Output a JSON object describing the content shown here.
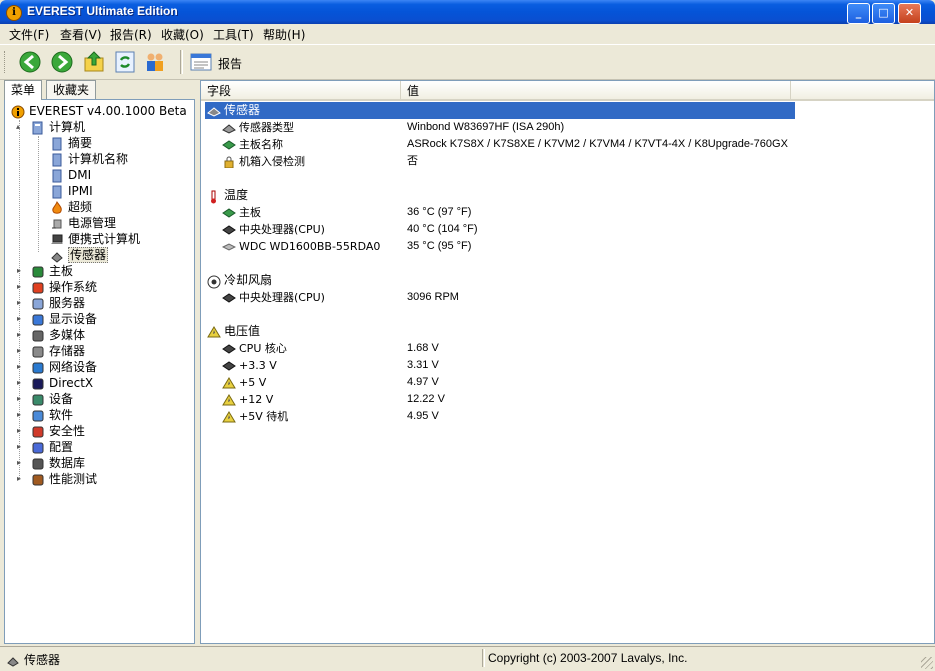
{
  "window": {
    "title": "EVEREST Ultimate Edition",
    "minimize": "_",
    "maximize": "□",
    "close": "✕"
  },
  "menubar": [
    "文件(F)",
    "查看(V)",
    "报告(R)",
    "收藏(O)",
    "工具(T)",
    "帮助(H)"
  ],
  "toolbar": {
    "report_label": "报告"
  },
  "left_tabs": [
    "菜单",
    "收藏夹"
  ],
  "tree": {
    "root": "EVEREST v4.00.1000 Beta",
    "computer": "计算机",
    "computer_children": [
      "摘要",
      "计算机名称",
      "DMI",
      "IPMI",
      "超频",
      "电源管理",
      "便携式计算机",
      "传感器"
    ],
    "top_items": [
      "主板",
      "操作系统",
      "服务器",
      "显示设备",
      "多媒体",
      "存储器",
      "网络设备",
      "DirectX",
      "设备",
      "软件",
      "安全性",
      "配置",
      "数据库",
      "性能测试"
    ]
  },
  "columns": {
    "field": "字段",
    "value": "值"
  },
  "sections": [
    {
      "title": "传感器",
      "rows": [
        {
          "field": "传感器类型",
          "value": "Winbond W83697HF  (ISA 290h)",
          "icon": "chip"
        },
        {
          "field": "主板名称",
          "value": "ASRock K7S8X / K7S8XE / K7VM2 / K7VM4 / K7VT4-4X / K8Upgrade-760GX",
          "icon": "board"
        },
        {
          "field": "机箱入侵检测",
          "value": "否",
          "icon": "lock"
        }
      ]
    },
    {
      "title": "温度",
      "rows": [
        {
          "field": "主板",
          "value": "36 °C  (97 °F)",
          "icon": "board"
        },
        {
          "field": "中央处理器(CPU)",
          "value": "40 °C  (104 °F)",
          "icon": "cpu"
        },
        {
          "field": "WDC WD1600BB-55RDA0",
          "value": "35 °C  (95 °F)",
          "icon": "hdd"
        }
      ]
    },
    {
      "title": "冷却风扇",
      "rows": [
        {
          "field": "中央处理器(CPU)",
          "value": "3096 RPM",
          "icon": "cpu"
        }
      ]
    },
    {
      "title": "电压值",
      "rows": [
        {
          "field": "CPU 核心",
          "value": "1.68 V",
          "icon": "cpu"
        },
        {
          "field": "+3.3 V",
          "value": "3.31 V",
          "icon": "cpu"
        },
        {
          "field": "+5 V",
          "value": "4.97 V",
          "icon": "warn"
        },
        {
          "field": "+12 V",
          "value": "12.22 V",
          "icon": "warn"
        },
        {
          "field": "+5V 待机",
          "value": "4.95 V",
          "icon": "warn"
        }
      ]
    }
  ],
  "status": {
    "left": "传感器",
    "right": "Copyright (c) 2003-2007 Lavalys, Inc."
  }
}
